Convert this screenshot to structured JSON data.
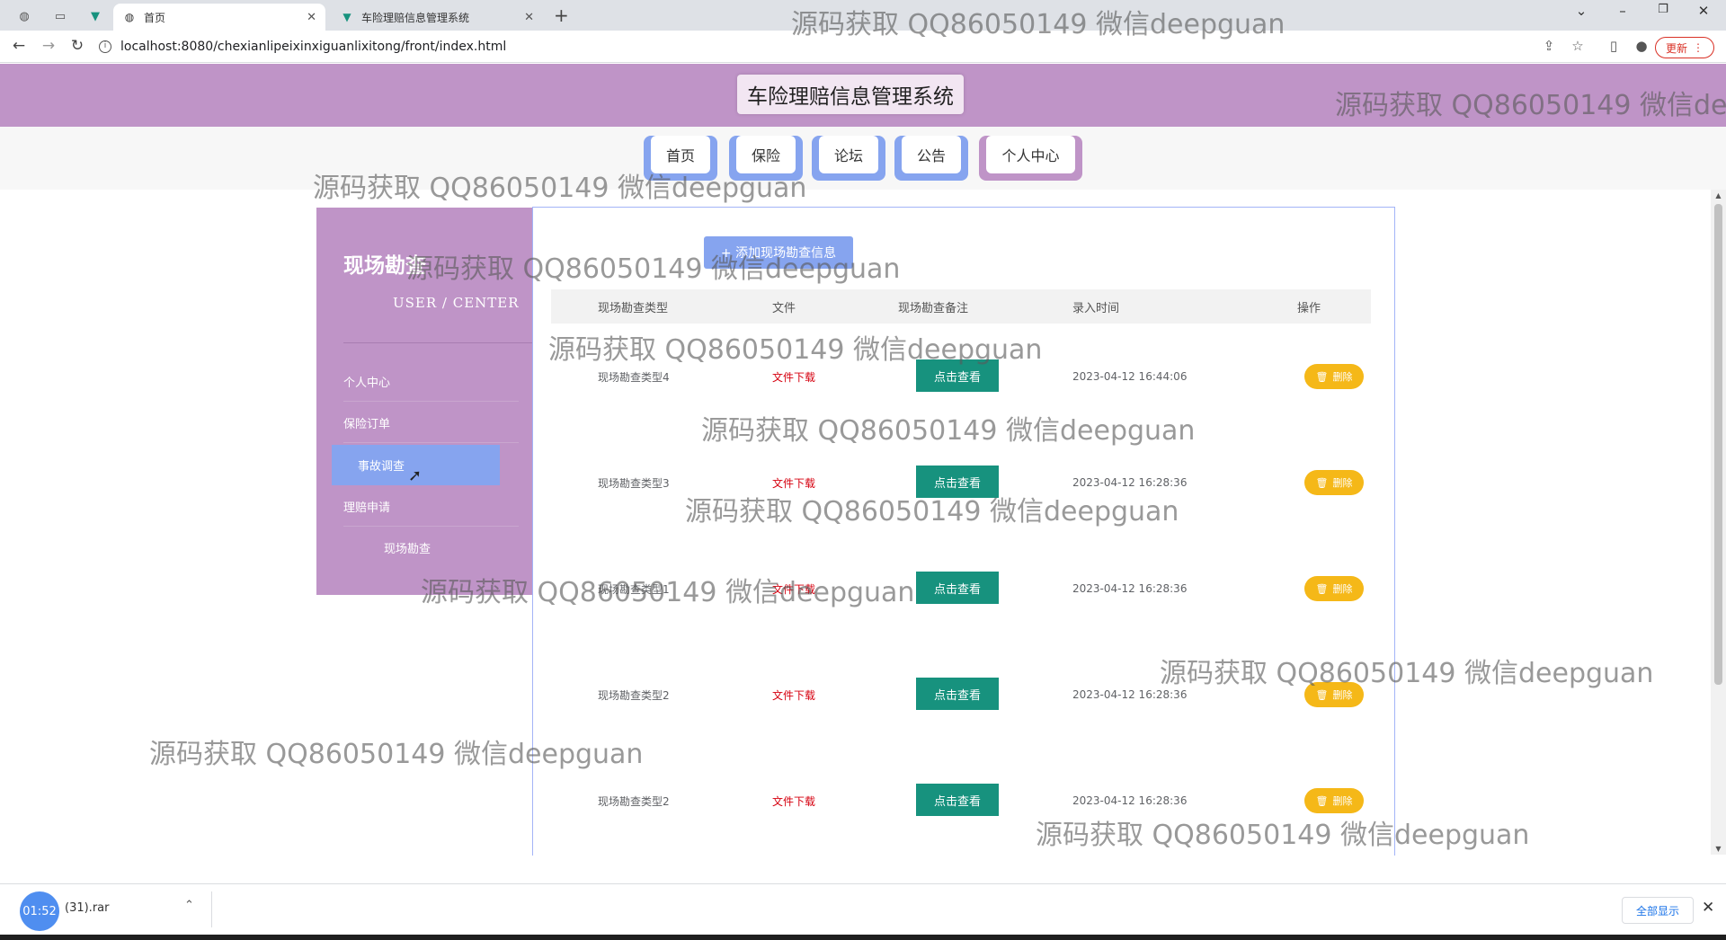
{
  "browser": {
    "tabs": [
      {
        "title": "首页",
        "active": true
      },
      {
        "title": "车险理赔信息管理系统",
        "active": false
      }
    ],
    "url": "localhost:8080/chexianlipeixinxiguanlixitong/front/index.html",
    "update_label": "更新"
  },
  "site": {
    "title": "车险理赔信息管理系统",
    "nav": [
      "首页",
      "保险",
      "论坛",
      "公告",
      "个人中心"
    ]
  },
  "sidebar": {
    "title": "现场勘查",
    "subtitle": "USER / CENTER",
    "items": [
      {
        "label": "个人中心"
      },
      {
        "label": "保险订单"
      },
      {
        "label": "事故调查",
        "active": true
      },
      {
        "label": "理赔申请"
      },
      {
        "label": "现场勘查"
      }
    ]
  },
  "main": {
    "add_button": "+ 添加现场勘查信息",
    "columns": [
      "现场勘查类型",
      "文件",
      "现场勘查备注",
      "录入时间",
      "操作"
    ],
    "rows": [
      {
        "type": "现场勘查类型4",
        "file": "文件下载",
        "remark": "点击查看",
        "time": "2023-04-12 16:44:06",
        "action": "删除"
      },
      {
        "type": "现场勘查类型3",
        "file": "文件下载",
        "remark": "点击查看",
        "time": "2023-04-12 16:28:36",
        "action": "删除"
      },
      {
        "type": "现场勘查类型1",
        "file": "文件下载",
        "remark": "点击查看",
        "time": "2023-04-12 16:28:36",
        "action": "删除"
      },
      {
        "type": "现场勘查类型2",
        "file": "文件下载",
        "remark": "点击查看",
        "time": "2023-04-12 16:28:36",
        "action": "删除"
      },
      {
        "type": "现场勘查类型2",
        "file": "文件下载",
        "remark": "点击查看",
        "time": "2023-04-12 16:28:36",
        "action": "删除"
      }
    ]
  },
  "download": {
    "time": "01:52",
    "filename": "(31).rar",
    "show_all": "全部显示"
  },
  "watermark": "源码获取 QQ86050149 微信deepguan",
  "colors": {
    "header": "#bf94c7",
    "accent": "#86a4ef",
    "view_button": "#17927e",
    "delete_button": "#f5b818",
    "download_link": "#d6000f"
  }
}
